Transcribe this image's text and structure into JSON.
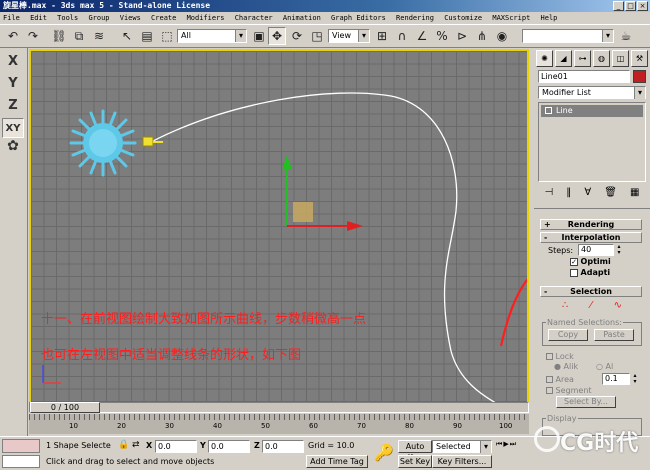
{
  "window": {
    "title": "旋星棒.max - 3ds max 5 - Stand-alone License",
    "controls": [
      "_",
      "□",
      "×"
    ]
  },
  "menu": [
    "File",
    "Edit",
    "Tools",
    "Group",
    "Views",
    "Create",
    "Modifiers",
    "Character",
    "Animation",
    "Graph Editors",
    "Rendering",
    "Customize",
    "MAXScript",
    "Help"
  ],
  "toolbar": {
    "selection_filter": "All",
    "reference_coord": "View"
  },
  "axis_constraints": [
    "X",
    "Y",
    "Z",
    "XY"
  ],
  "command_panel": {
    "object_name": "Line01",
    "object_color": "#c0201f",
    "modifier_list": "Modifier List",
    "stack_item": "Line",
    "rollouts": {
      "rendering": "Rendering",
      "interpolation": "Interpolation",
      "selection": "Selection"
    },
    "steps_label": "Steps:",
    "steps_value": "40",
    "optimize_label": "Optimi",
    "adaptive_label": "Adapti",
    "named_selections": "Named Selections:",
    "copy_label": "Copy",
    "paste_label": "Paste",
    "lock_label": "Lock",
    "alike_label": "Alik",
    "all_label": "Al",
    "area_label": "Area",
    "area_value": "0.1",
    "segment_label": "Segment",
    "select_by_label": "Select By...",
    "display_label": "Display"
  },
  "timeline": {
    "slider_label": "0 / 100",
    "ticks": [
      "10",
      "20",
      "30",
      "40",
      "50",
      "60",
      "70",
      "80",
      "90",
      "100"
    ]
  },
  "status": {
    "selection_text": "1 Shape Selecte",
    "x_value": "0.0",
    "y_value": "0.0",
    "z_value": "0.0",
    "grid": "Grid = 10.0",
    "prompt": "Click and drag to select and move objects",
    "add_time_tag": "Add Time Tag",
    "auto_key": "Auto Key",
    "set_key": "Set Key",
    "selected": "Selected",
    "key_filters": "Key Filters..."
  },
  "annotation": {
    "line1": "十一、在前视图绘制大致如图所示曲线，步数稍微高一点",
    "line2": "也可在左视图中适当调整线条的形状，如下图"
  },
  "watermark": "CG时代",
  "colors": {
    "annotation": "#ff1e1e",
    "viewport_border": "#e8d200",
    "star_object": "#5ec8e8"
  }
}
